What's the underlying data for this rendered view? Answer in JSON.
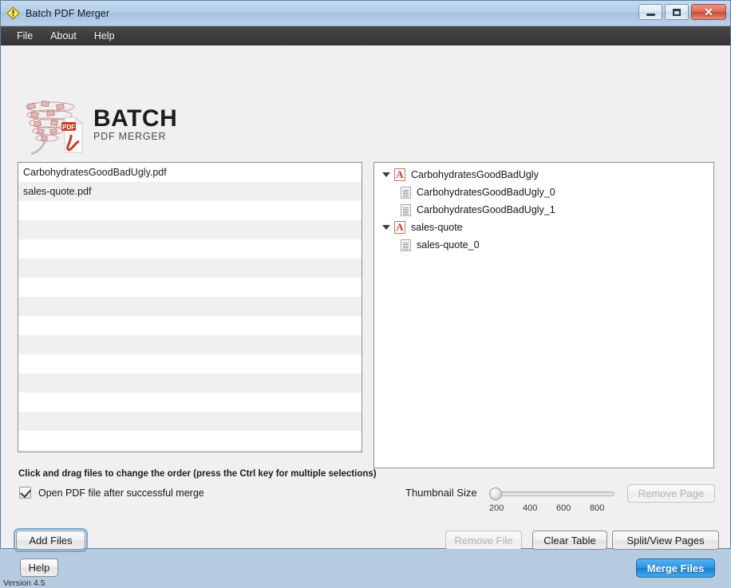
{
  "window": {
    "title": "Batch PDF Merger",
    "app_icon": "warning-diamond-icon",
    "controls": {
      "minimize": "minimize-icon",
      "restore": "restore-icon",
      "close": "✕"
    }
  },
  "menubar": {
    "items": [
      {
        "label": "File"
      },
      {
        "label": "About"
      },
      {
        "label": "Help"
      }
    ]
  },
  "logo": {
    "title": "BATCH",
    "subtitle": "PDF MERGER"
  },
  "file_list": {
    "rows": [
      {
        "name": "CarbohydratesGoodBadUgly.pdf"
      },
      {
        "name": "sales-quote.pdf"
      }
    ],
    "empty_rows": 14,
    "hint": "Click and drag files to change the order (press the Ctrl key for multiple selections)"
  },
  "options": {
    "open_after_merge": {
      "label": "Open PDF file after successful merge",
      "checked": true
    }
  },
  "tree": {
    "nodes": [
      {
        "label": "CarbohydratesGoodBadUgly",
        "icon": "pdf-file-icon",
        "expanded": true,
        "children": [
          {
            "label": "CarbohydratesGoodBadUgly_0",
            "icon": "page-icon"
          },
          {
            "label": "CarbohydratesGoodBadUgly_1",
            "icon": "page-icon"
          }
        ]
      },
      {
        "label": "sales-quote",
        "icon": "pdf-file-icon",
        "expanded": true,
        "children": [
          {
            "label": "sales-quote_0",
            "icon": "page-icon"
          }
        ]
      }
    ]
  },
  "thumbnail": {
    "label": "Thumbnail Size",
    "value": 200,
    "min": 200,
    "max": 900,
    "ticks": [
      "200",
      "400",
      "600",
      "800"
    ]
  },
  "buttons": {
    "add_files": {
      "label": "Add Files",
      "enabled": true,
      "focused": true
    },
    "help": {
      "label": "Help",
      "enabled": true
    },
    "remove_page": {
      "label": "Remove Page",
      "enabled": false
    },
    "remove_file": {
      "label": "Remove File",
      "enabled": false
    },
    "clear_table": {
      "label": "Clear Table",
      "enabled": true
    },
    "split_view_pages": {
      "label": "Split/View Pages",
      "enabled": true
    },
    "merge_files": {
      "label": "Merge Files",
      "enabled": true
    }
  },
  "footer": {
    "version": "Version 4.5"
  },
  "colors": {
    "accent": "#1580d2",
    "pdf_red": "#cf3b28",
    "menubar": "#3c3c3c",
    "titlebar": "#b5cde6"
  }
}
